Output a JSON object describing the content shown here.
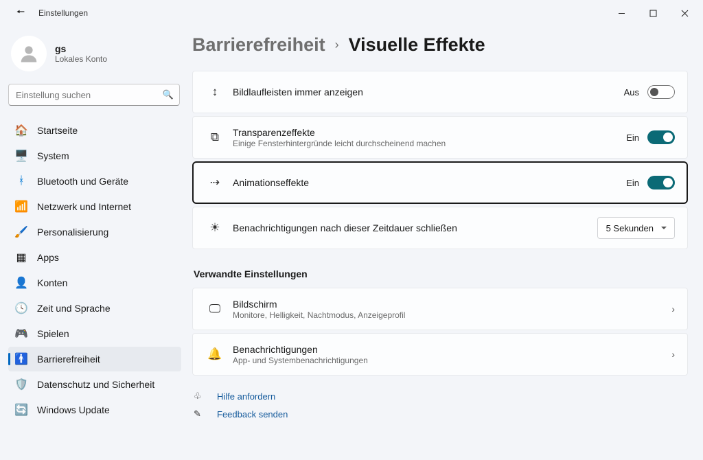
{
  "window": {
    "title": "Einstellungen"
  },
  "user": {
    "name": "gs",
    "account_type": "Lokales Konto"
  },
  "search": {
    "placeholder": "Einstellung suchen"
  },
  "nav": {
    "home": "Startseite",
    "system": "System",
    "bluetooth": "Bluetooth und Geräte",
    "network": "Netzwerk und Internet",
    "personalization": "Personalisierung",
    "apps": "Apps",
    "accounts": "Konten",
    "time": "Zeit und Sprache",
    "gaming": "Spielen",
    "accessibility": "Barrierefreiheit",
    "privacy": "Datenschutz und Sicherheit",
    "update": "Windows Update"
  },
  "breadcrumb": {
    "parent": "Barrierefreiheit",
    "current": "Visuelle Effekte"
  },
  "settings": {
    "scrollbars": {
      "title": "Bildlaufleisten immer anzeigen",
      "state": "Aus"
    },
    "transparency": {
      "title": "Transparenzeffekte",
      "sub": "Einige Fensterhintergründe leicht durchscheinend machen",
      "state": "Ein"
    },
    "animations": {
      "title": "Animationseffekte",
      "state": "Ein"
    },
    "notifications_timeout": {
      "title": "Benachrichtigungen nach dieser Zeitdauer schließen",
      "value": "5 Sekunden"
    }
  },
  "related": {
    "heading": "Verwandte Einstellungen",
    "display": {
      "title": "Bildschirm",
      "sub": "Monitore, Helligkeit, Nachtmodus, Anzeigeprofil"
    },
    "notifications": {
      "title": "Benachrichtigungen",
      "sub": "App- und Systembenachrichtigungen"
    }
  },
  "footer": {
    "help": "Hilfe anfordern",
    "feedback": "Feedback senden"
  }
}
